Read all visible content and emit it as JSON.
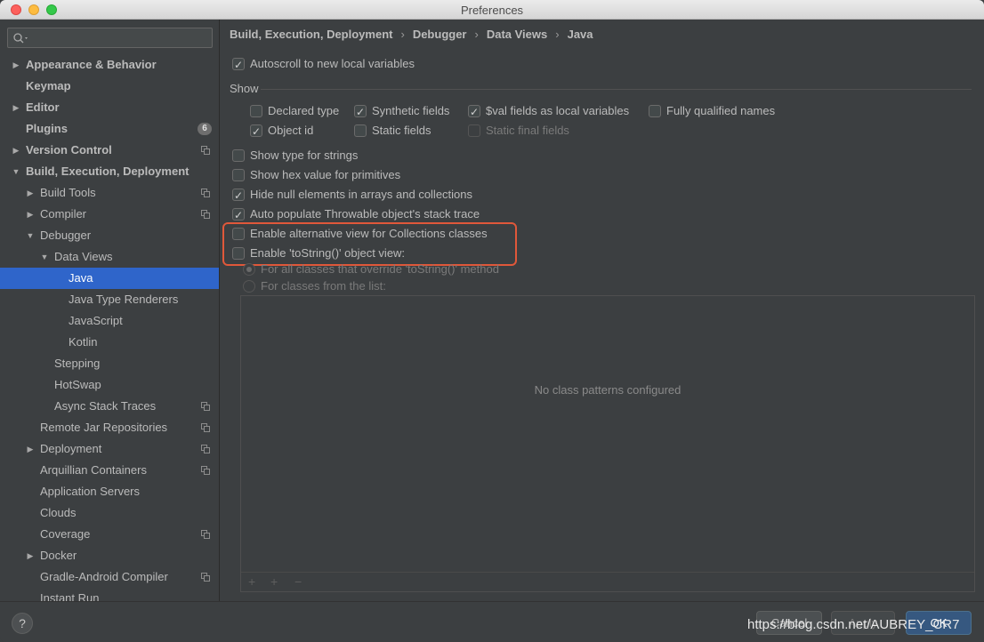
{
  "window": {
    "title": "Preferences"
  },
  "sidebar": {
    "search": {
      "placeholder": ""
    },
    "items": [
      {
        "label": "Appearance & Behavior",
        "bold": true,
        "arrow": "right",
        "level": 0
      },
      {
        "label": "Keymap",
        "bold": true,
        "arrow": "",
        "level": 0
      },
      {
        "label": "Editor",
        "bold": true,
        "arrow": "right",
        "level": 0
      },
      {
        "label": "Plugins",
        "bold": true,
        "arrow": "",
        "level": 0,
        "badge": "6"
      },
      {
        "label": "Version Control",
        "bold": true,
        "arrow": "right",
        "level": 0,
        "copy": true
      },
      {
        "label": "Build, Execution, Deployment",
        "bold": true,
        "arrow": "down",
        "level": 0
      },
      {
        "label": "Build Tools",
        "arrow": "right",
        "level": 1,
        "copy": true
      },
      {
        "label": "Compiler",
        "arrow": "right",
        "level": 1,
        "copy": true
      },
      {
        "label": "Debugger",
        "arrow": "down",
        "level": 1
      },
      {
        "label": "Data Views",
        "arrow": "down",
        "level": 2
      },
      {
        "label": "Java",
        "arrow": "",
        "level": 3,
        "selected": true
      },
      {
        "label": "Java Type Renderers",
        "arrow": "",
        "level": 3
      },
      {
        "label": "JavaScript",
        "arrow": "",
        "level": 3
      },
      {
        "label": "Kotlin",
        "arrow": "",
        "level": 3
      },
      {
        "label": "Stepping",
        "arrow": "",
        "level": 2
      },
      {
        "label": "HotSwap",
        "arrow": "",
        "level": 2
      },
      {
        "label": "Async Stack Traces",
        "arrow": "",
        "level": 2,
        "copy": true
      },
      {
        "label": "Remote Jar Repositories",
        "arrow": "",
        "level": 1,
        "copy": true
      },
      {
        "label": "Deployment",
        "arrow": "right",
        "level": 1,
        "copy": true
      },
      {
        "label": "Arquillian Containers",
        "arrow": "",
        "level": 1,
        "copy": true
      },
      {
        "label": "Application Servers",
        "arrow": "",
        "level": 1
      },
      {
        "label": "Clouds",
        "arrow": "",
        "level": 1
      },
      {
        "label": "Coverage",
        "arrow": "",
        "level": 1,
        "copy": true
      },
      {
        "label": "Docker",
        "arrow": "right",
        "level": 1
      },
      {
        "label": "Gradle-Android Compiler",
        "arrow": "",
        "level": 1,
        "copy": true
      },
      {
        "label": "Instant Run",
        "arrow": "",
        "level": 1
      }
    ]
  },
  "breadcrumb": {
    "items": [
      "Build, Execution, Deployment",
      "Debugger",
      "Data Views",
      "Java"
    ],
    "separator": "›"
  },
  "options": {
    "autoscroll": {
      "label": "Autoscroll to new local variables",
      "checked": true
    },
    "show_group_label": "Show",
    "show": {
      "declared_type": {
        "label": "Declared type",
        "checked": false
      },
      "synthetic_fields": {
        "label": "Synthetic fields",
        "checked": true
      },
      "val_fields": {
        "label": "$val fields as local variables",
        "checked": true
      },
      "fully_qualified": {
        "label": "Fully qualified names",
        "checked": false
      },
      "object_id": {
        "label": "Object id",
        "checked": true
      },
      "static_fields": {
        "label": "Static fields",
        "checked": false
      },
      "static_final": {
        "label": "Static final fields",
        "checked": false,
        "disabled": true
      }
    },
    "type_for_strings": {
      "label": "Show type for strings",
      "checked": false
    },
    "hex_primitives": {
      "label": "Show hex value for primitives",
      "checked": false
    },
    "hide_null": {
      "label": "Hide null elements in arrays and collections",
      "checked": true
    },
    "auto_populate": {
      "label": "Auto populate Throwable object's stack trace",
      "checked": true
    },
    "alt_collections": {
      "label": "Enable alternative view for Collections classes",
      "checked": false
    },
    "tostring_view": {
      "label": "Enable 'toString()' object view:",
      "checked": false
    },
    "tostring_all": {
      "label": "For all classes that override 'toString()' method",
      "selected": true,
      "disabled": true
    },
    "tostring_list": {
      "label": "For classes from the list:",
      "selected": false,
      "disabled": true
    }
  },
  "patterns": {
    "empty_text": "No class patterns configured",
    "toolbar": {
      "add": "+",
      "add_pattern": "+",
      "remove": "−"
    }
  },
  "footer": {
    "help": "?",
    "cancel": "Cancel",
    "apply": "Apply",
    "ok": "OK",
    "watermark": "https://blog.csdn.net/AUBREY_CR7"
  },
  "colors": {
    "selection": "#2f65ca",
    "highlight_box": "#e0583a",
    "background": "#3c3f41"
  }
}
